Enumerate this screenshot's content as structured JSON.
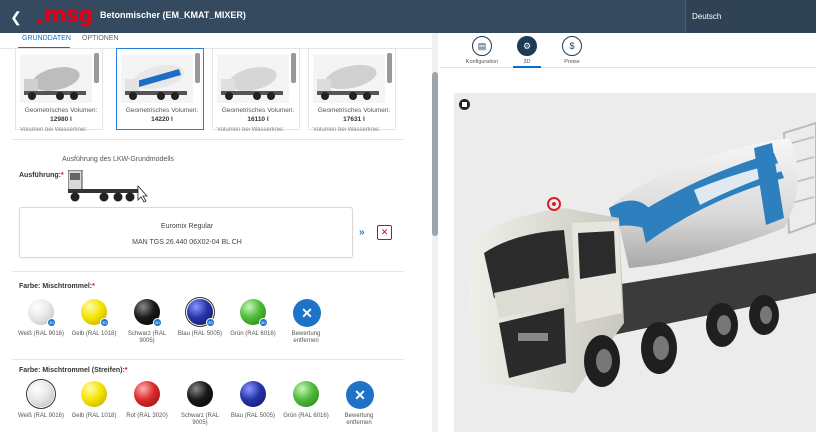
{
  "header": {
    "back_icon": "chevron-left-icon",
    "logo_text": "msg",
    "title": "Betonmischer (EM_KMAT_MIXER)",
    "language": "Deutsch",
    "colors": {
      "bar": "#354a5f",
      "logo": "#e10019"
    }
  },
  "left": {
    "tabs": [
      {
        "label": "GRUNDDATEN",
        "active": true
      },
      {
        "label": "OPTIONEN",
        "active": false
      }
    ],
    "products": [
      {
        "label": "Geometrisches Volumen:",
        "value": "12980 l",
        "selected": false
      },
      {
        "label": "Geometrisches Volumen:",
        "value": "14220 l",
        "selected": true
      },
      {
        "label": "Geometrisches Volumen:",
        "value": "16110 l",
        "selected": false
      },
      {
        "label": "Geometrisches Volumen:",
        "value": "17631 l",
        "selected": false
      }
    ],
    "products_cut_text": "Volumen bei Wasserlinie:",
    "execution_caption": "Ausführung des LKW-Grundmodells",
    "execution_label": "Ausführung:",
    "required_mark": "*",
    "execution_box": {
      "line1": "Euromix Regular",
      "line2": "MAN TGS 26.440 06X02-04 BL CH"
    },
    "drum_color_label": "Farbe: Mischtrommel:",
    "drum_colors": [
      {
        "name": "Weiß (RAL 9016)",
        "color": "#f2f2f2",
        "selected": false
      },
      {
        "name": "Gelb (RAL 1018)",
        "color": "#f5e400",
        "selected": false
      },
      {
        "name": "Schwarz (RAL 9005)",
        "color": "#1a1a1a",
        "selected": false
      },
      {
        "name": "Blau (RAL 5005)",
        "color": "#2534a8",
        "selected": true
      },
      {
        "name": "Grün (RAL 6016)",
        "color": "#4dbb38",
        "selected": false
      }
    ],
    "drum_remove_label": "Bewertung entfernen",
    "stripe_color_label": "Farbe: Mischtrommel (Streifen):",
    "stripe_colors": [
      {
        "name": "Weiß (RAL 9016)",
        "color": "#f2f2f2",
        "selected": true
      },
      {
        "name": "Gelb (RAL 1018)",
        "color": "#f5e400",
        "selected": false
      },
      {
        "name": "Rot (RAL 3020)",
        "color": "#d92b2b",
        "selected": false
      },
      {
        "name": "Schwarz (RAL 9005)",
        "color": "#1a1a1a",
        "selected": false
      },
      {
        "name": "Blau (RAL 5005)",
        "color": "#2534a8",
        "selected": false
      },
      {
        "name": "Grün (RAL 6016)",
        "color": "#4dbb38",
        "selected": false
      }
    ],
    "stripe_remove_label": "Bewertung entfernen"
  },
  "right": {
    "tabs": [
      {
        "label": "Konfiguration",
        "icon": "clipboard-icon",
        "active": false
      },
      {
        "label": "3D",
        "icon": "mixer-3d-icon",
        "active": true
      },
      {
        "label": "Preise",
        "icon": "dollar-icon",
        "active": false
      }
    ]
  }
}
